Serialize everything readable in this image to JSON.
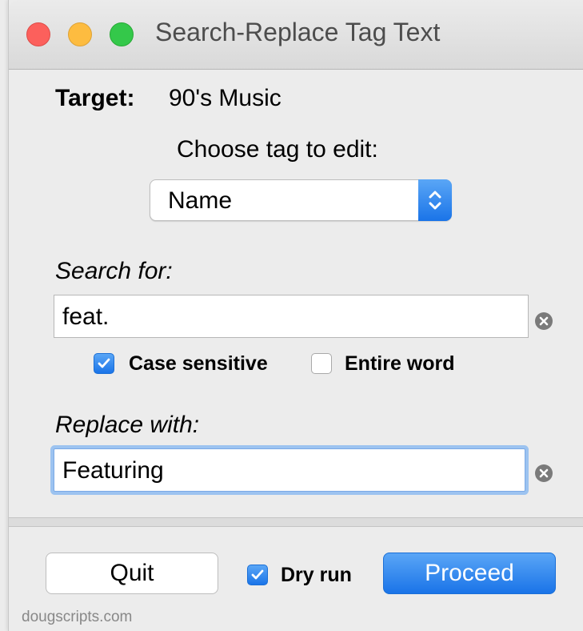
{
  "window": {
    "title": "Search-Replace Tag Text"
  },
  "target": {
    "label": "Target:",
    "value": "90's Music"
  },
  "tag_choice": {
    "label": "Choose tag to edit:",
    "selected": "Name"
  },
  "search": {
    "label": "Search for:",
    "value": "feat."
  },
  "options": {
    "case_sensitive_label": "Case sensitive",
    "case_sensitive_checked": true,
    "entire_word_label": "Entire word",
    "entire_word_checked": false
  },
  "replace": {
    "label": "Replace with:",
    "value": "Featuring"
  },
  "footer_buttons": {
    "quit_label": "Quit",
    "dry_run_label": "Dry run",
    "dry_run_checked": true,
    "proceed_label": "Proceed"
  },
  "credit": "dougscripts.com",
  "colors": {
    "accent": "#1a74e8",
    "close": "#fc605c",
    "minimize": "#fdbc40",
    "maximize": "#34c84a"
  }
}
